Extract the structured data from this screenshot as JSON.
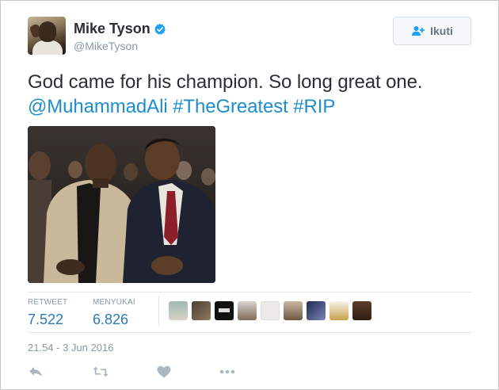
{
  "user": {
    "name": "Mike Tyson",
    "handle": "@MikeTyson"
  },
  "follow_button": {
    "label": "Ikuti"
  },
  "tweet": {
    "text_plain": "God came for his champion. So long great one.",
    "mention": "@MuhammadAli",
    "hashtags": [
      "#TheGreatest",
      "#RIP"
    ]
  },
  "stats": {
    "retweets": {
      "label": "RETWEET",
      "value": "7.522"
    },
    "likes": {
      "label": "MENYUKAI",
      "value": "6.826"
    }
  },
  "timestamp": "21.54 - 3 Jun 2016",
  "likers_count_shown": 9,
  "icons": {
    "verified": "verified-badge-icon",
    "follow": "add-user-icon",
    "reply": "reply-icon",
    "retweet": "retweet-icon",
    "like": "heart-icon",
    "more": "more-icon"
  },
  "colors": {
    "link": "#1d8dcd",
    "stat_value": "#2b7bb9",
    "verified": "#1da1f2",
    "muted": "#8899a6"
  }
}
